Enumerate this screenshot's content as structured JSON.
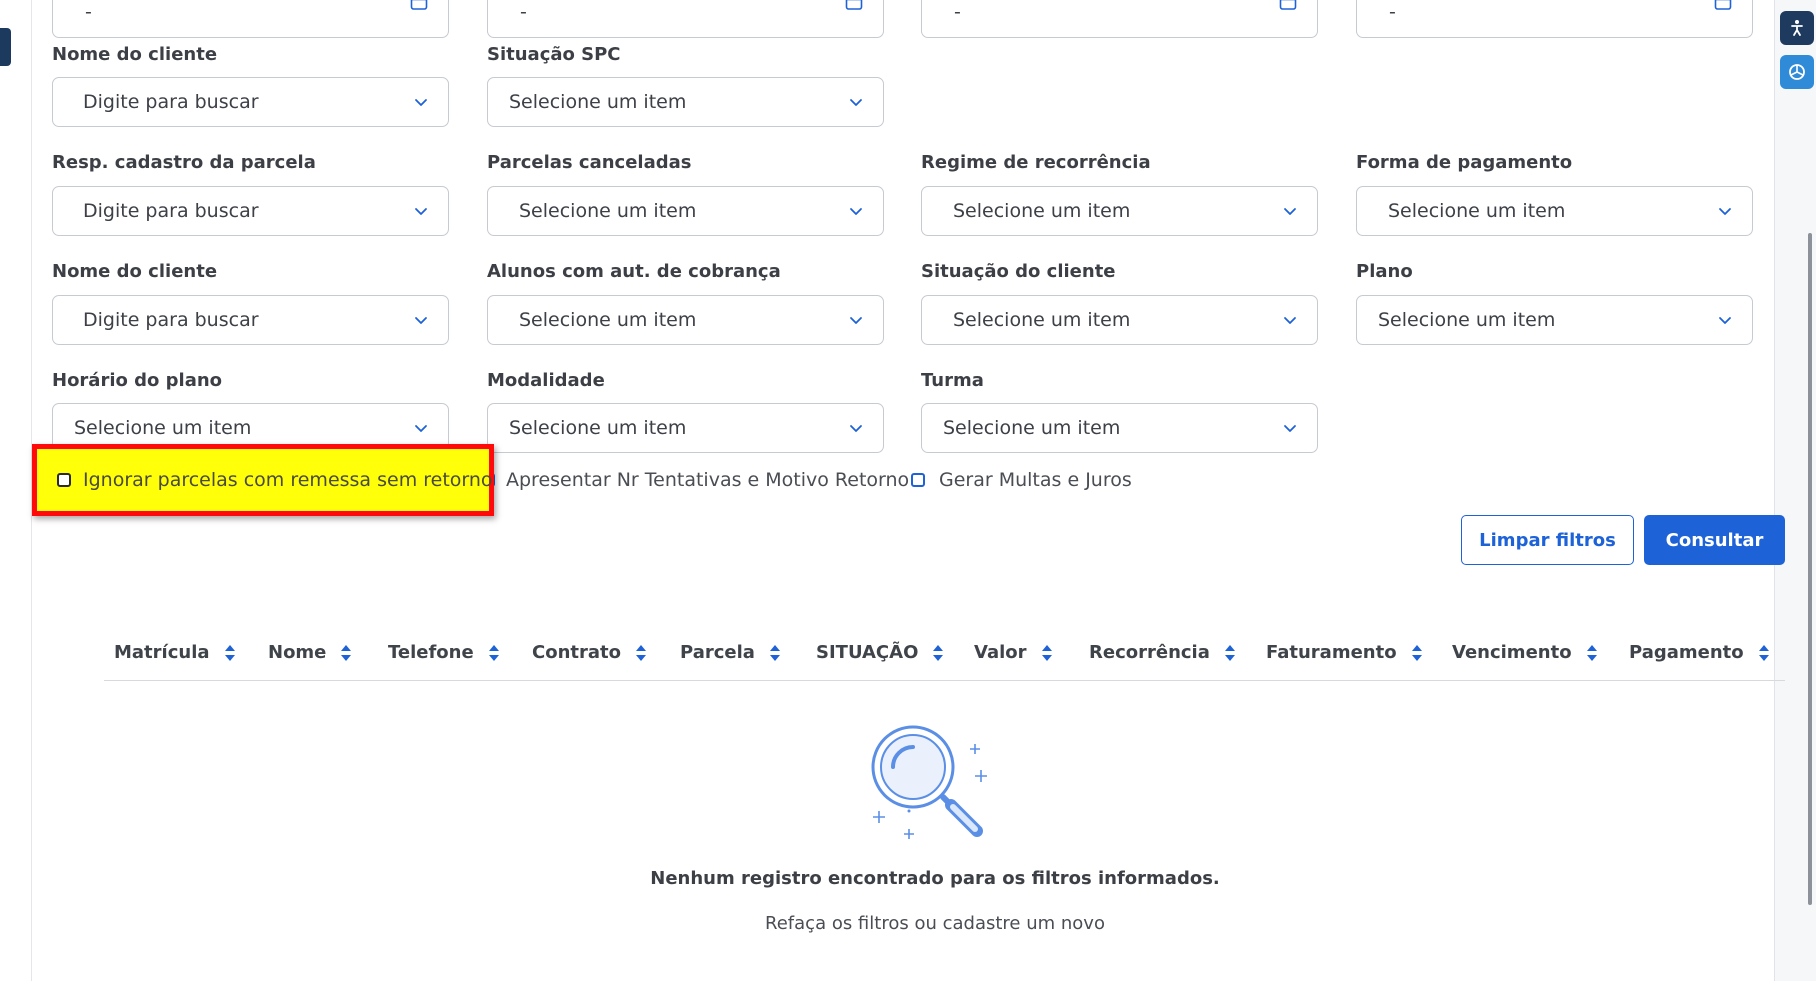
{
  "date_fields": [
    {
      "value": "-"
    },
    {
      "value": "-"
    },
    {
      "value": "-"
    },
    {
      "value": "-"
    }
  ],
  "filters": {
    "nome_cliente_1": {
      "label": "Nome do cliente",
      "value": "Digite para buscar"
    },
    "situacao_spc": {
      "label": "Situação SPC",
      "value": "Selecione um item"
    },
    "resp_cadastro": {
      "label": "Resp. cadastro da parcela",
      "value": "Digite para buscar"
    },
    "parcelas_canceladas": {
      "label": "Parcelas canceladas",
      "value": "Selecione um item"
    },
    "regime_recorrencia": {
      "label": "Regime de recorrência",
      "value": "Selecione um item"
    },
    "forma_pagamento": {
      "label": "Forma de pagamento",
      "value": "Selecione um item"
    },
    "nome_cliente_2": {
      "label": "Nome do cliente",
      "value": "Digite para buscar"
    },
    "alunos_aut_cobranca": {
      "label": "Alunos com aut. de cobrança",
      "value": "Selecione um item"
    },
    "situacao_cliente": {
      "label": "Situação do cliente",
      "value": "Selecione um item"
    },
    "plano": {
      "label": "Plano",
      "value": "Selecione um item"
    },
    "horario_plano": {
      "label": "Horário do plano",
      "value": "Selecione um item"
    },
    "modalidade": {
      "label": "Modalidade",
      "value": "Selecione um item"
    },
    "turma": {
      "label": "Turma",
      "value": "Selecione um item"
    }
  },
  "checkboxes": {
    "ignorar_parcelas": {
      "label": "Ignorar parcelas com remessa sem retorno",
      "checked": false
    },
    "apresentar_tentativas": {
      "label": "Apresentar Nr Tentativas e Motivo Retorno",
      "checked": false
    },
    "gerar_multas": {
      "label": "Gerar Multas e Juros",
      "checked": false
    }
  },
  "buttons": {
    "limpar": "Limpar filtros",
    "consultar": "Consultar"
  },
  "table": {
    "columns": [
      "Matrícula",
      "Nome",
      "Telefone",
      "Contrato",
      "Parcela",
      "SITUAÇÃO",
      "Valor",
      "Recorrência",
      "Faturamento",
      "Vencimento",
      "Pagamento"
    ]
  },
  "empty_state": {
    "title": "Nenhum registro encontrado para os filtros informados.",
    "subtitle": "Refaça os filtros ou cadastre um novo"
  },
  "colors": {
    "primary": "#1e62d8",
    "highlight_fill": "#ffff0a",
    "highlight_border": "#ff0a0a"
  },
  "icons": {
    "calendar": "calendar-icon",
    "dropdown": "chevron-down-icon",
    "sort": "sort-icon",
    "empty": "magnifier-illustration"
  }
}
